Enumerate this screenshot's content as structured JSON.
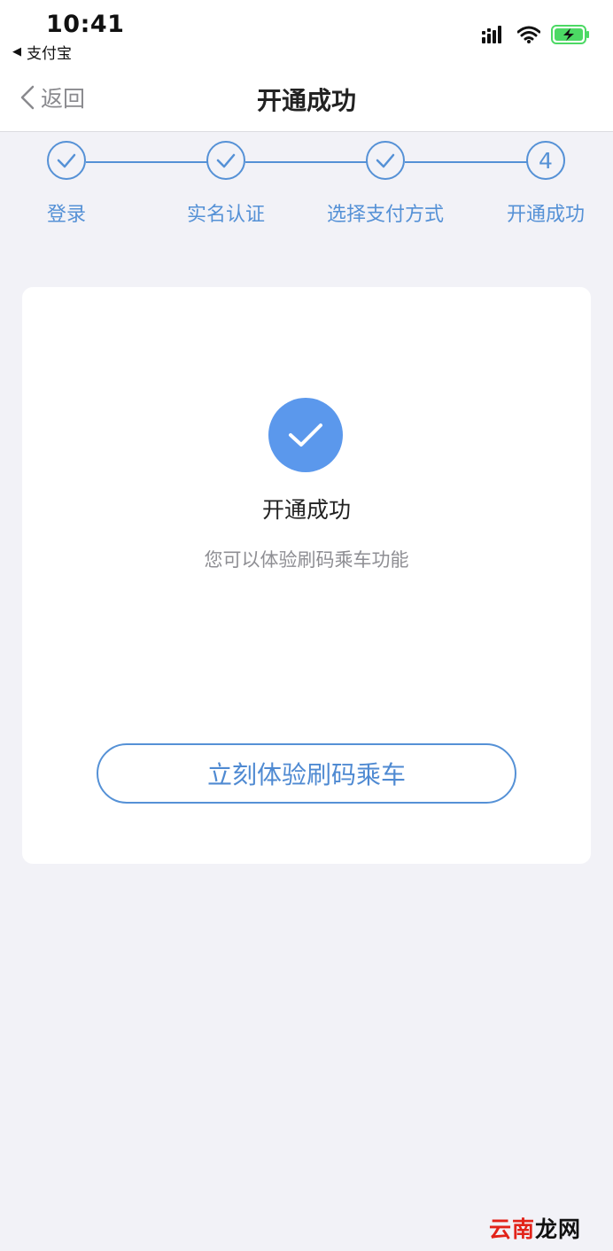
{
  "status_bar": {
    "time": "10:41",
    "back_app_label": "支付宝",
    "icons": [
      "signal-icon",
      "wifi-icon",
      "battery-charging-icon"
    ]
  },
  "nav": {
    "back_label": "返回",
    "title": "开通成功"
  },
  "steps": [
    {
      "label": "登录",
      "state": "done"
    },
    {
      "label": "实名认证",
      "state": "done"
    },
    {
      "label": "选择支付方式",
      "state": "done"
    },
    {
      "label": "开通成功",
      "state": "current",
      "number": "4"
    }
  ],
  "result": {
    "icon": "check-icon",
    "title": "开通成功",
    "subtitle": "您可以体验刷码乘车功能",
    "button_label": "立刻体验刷码乘车"
  },
  "watermark": {
    "part1": "云南",
    "part2": "龙网"
  },
  "colors": {
    "accent": "#5591d6",
    "success_fill": "#5b98ec",
    "background": "#f2f2f7",
    "battery": "#4cd964"
  }
}
